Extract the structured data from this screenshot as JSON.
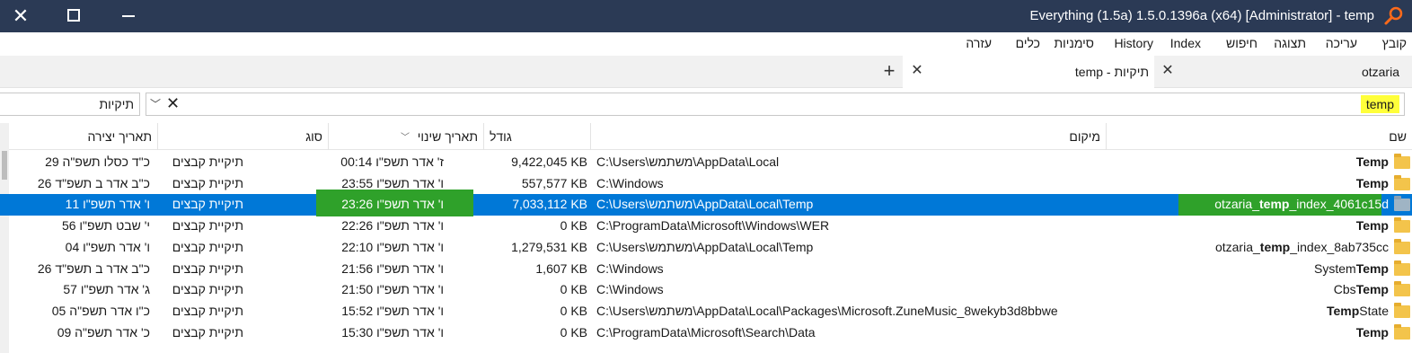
{
  "window": {
    "title": "Everything (1.5a) 1.5.0.1396a (x64) [Administrator] - temp"
  },
  "menubar": {
    "items": [
      "קובץ",
      "עריכה",
      "תצוגה",
      "חיפוש",
      "Index",
      "History",
      "סימניות",
      "כלים",
      "עזרה"
    ]
  },
  "tabs": [
    {
      "label": "otzaria",
      "active": false
    },
    {
      "label": "temp - תיקיות",
      "active": true
    }
  ],
  "search": {
    "query": "temp",
    "filter": "תיקיות"
  },
  "columns": {
    "name": "שם",
    "path": "מיקום",
    "size": "גודל",
    "modified": "תאריך שינוי",
    "type": "סוג",
    "created": "תאריך יצירה"
  },
  "rows": [
    {
      "name_pre": "",
      "name_bold": "Temp",
      "name_post": "",
      "path": "C:\\Users\\משתמש\\AppData\\Local",
      "size": "9,422,045 KB",
      "modified": "ז' אדר תשפ\"ו 00:14",
      "type": "תיקיית קבצים",
      "created": "כ\"ד כסלו תשפ\"ה 29"
    },
    {
      "name_pre": "",
      "name_bold": "Temp",
      "name_post": "",
      "path": "C:\\Windows",
      "size": "557,577 KB",
      "modified": "ו' אדר תשפ\"ו 23:55",
      "type": "תיקיית קבצים",
      "created": "כ\"ב אדר ב תשפ\"ד 26"
    },
    {
      "name_pre": "otzaria_",
      "name_bold": "temp",
      "name_post": "_index_4061c15d",
      "path": "C:\\Users\\משתמש\\AppData\\Local\\Temp",
      "size": "7,033,112 KB",
      "modified": "ו' אדר תשפ\"ו 23:26",
      "type": "תיקיית קבצים",
      "created": "ו' אדר תשפ\"ו 11",
      "selected": true
    },
    {
      "name_pre": "",
      "name_bold": "Temp",
      "name_post": "",
      "path": "C:\\ProgramData\\Microsoft\\Windows\\WER",
      "size": "0 KB",
      "modified": "ו' אדר תשפ\"ו 22:26",
      "type": "תיקיית קבצים",
      "created": "י' שבט תשפ\"ו 56"
    },
    {
      "name_pre": "otzaria_",
      "name_bold": "temp",
      "name_post": "_index_8ab735cc",
      "path": "C:\\Users\\משתמש\\AppData\\Local\\Temp",
      "size": "1,279,531 KB",
      "modified": "ו' אדר תשפ\"ו 22:10",
      "type": "תיקיית קבצים",
      "created": "ו' אדר תשפ\"ו 04"
    },
    {
      "name_pre": "System",
      "name_bold": "Temp",
      "name_post": "",
      "path": "C:\\Windows",
      "size": "1,607 KB",
      "modified": "ו' אדר תשפ\"ו 21:56",
      "type": "תיקיית קבצים",
      "created": "כ\"ב אדר ב תשפ\"ד 26"
    },
    {
      "name_pre": "Cbs",
      "name_bold": "Temp",
      "name_post": "",
      "path": "C:\\Windows",
      "size": "0 KB",
      "modified": "ו' אדר תשפ\"ו 21:50",
      "type": "תיקיית קבצים",
      "created": "ג' אדר תשפ\"ו 57"
    },
    {
      "name_pre": "",
      "name_bold": "Temp",
      "name_post": "State",
      "path": "C:\\Users\\משתמש\\AppData\\Local\\Packages\\Microsoft.ZuneMusic_8wekyb3d8bbwe",
      "size": "0 KB",
      "modified": "ו' אדר תשפ\"ו 15:52",
      "type": "תיקיית קבצים",
      "created": "כ\"ו אדר תשפ\"ה 05"
    },
    {
      "name_pre": "",
      "name_bold": "Temp",
      "name_post": "",
      "path": "C:\\ProgramData\\Microsoft\\Search\\Data",
      "size": "0 KB",
      "modified": "ו' אדר תשפ\"ו 15:30",
      "type": "תיקיית קבצים",
      "created": "כ' אדר תשפ\"ה 09"
    }
  ],
  "colors": {
    "titlebar": "#2b3a55",
    "selection": "#0078d7",
    "highlight": "#ffff3a"
  }
}
